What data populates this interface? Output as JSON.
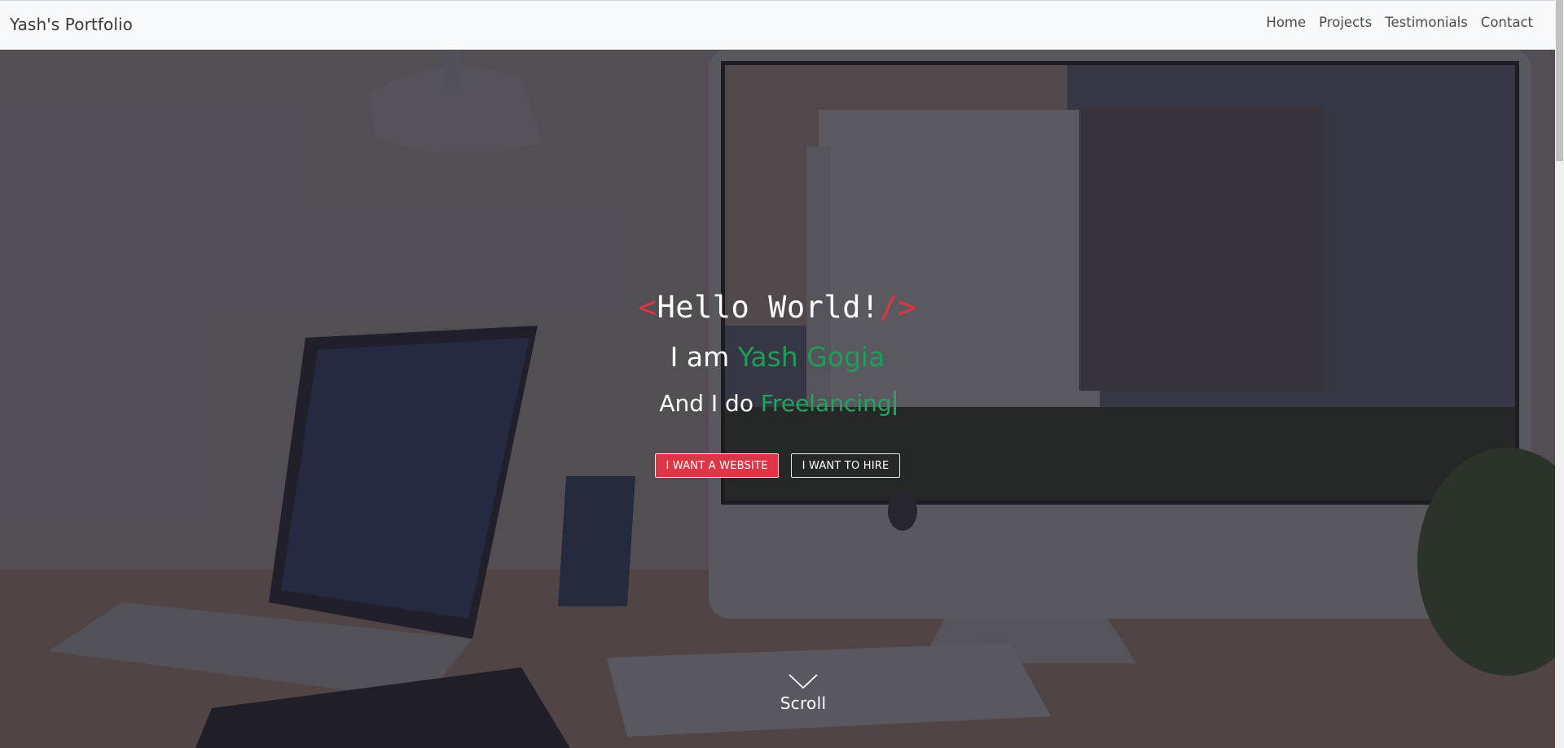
{
  "navbar": {
    "brand": "Yash's Portfolio",
    "links": [
      "Home",
      "Projects",
      "Testimonials",
      "Contact"
    ]
  },
  "hero": {
    "hello_open": "<",
    "hello_text": "Hello World!",
    "hello_close": "/>",
    "iam_prefix": "I am",
    "name": "Yash Gogia",
    "ido_prefix": "And I do",
    "typed_word": "Freelancing",
    "buttons": {
      "primary": "I WANT A WEBSITE",
      "secondary": "I WANT TO HIRE"
    },
    "scroll_label": "Scroll"
  },
  "colors": {
    "accent_red": "#dc3545",
    "accent_green": "#1f9d57",
    "navbar_bg": "#f8f9fb"
  }
}
